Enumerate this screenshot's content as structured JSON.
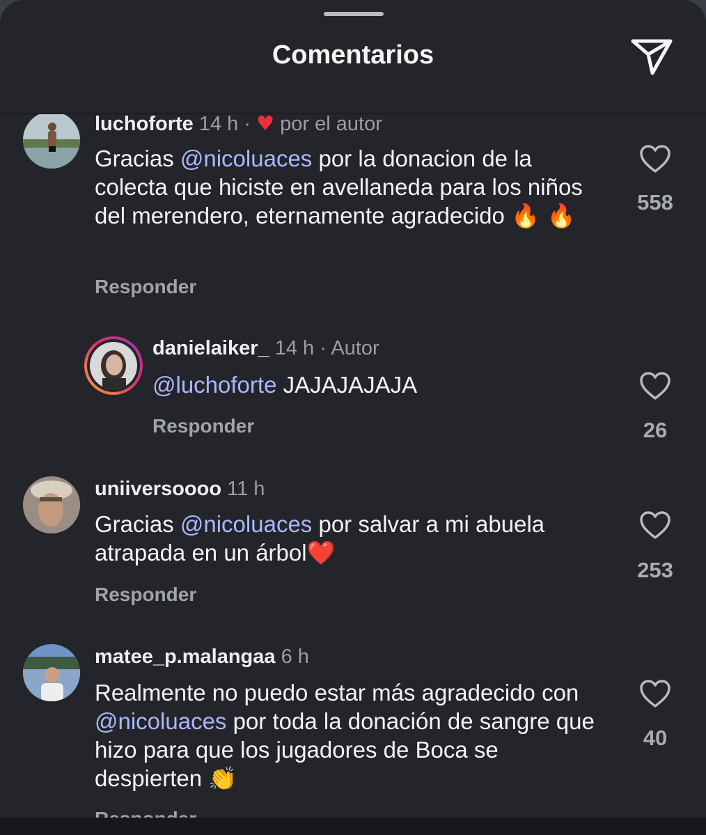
{
  "header": {
    "title": "Comentarios"
  },
  "comments": [
    {
      "username": "luchoforte",
      "time": "14 h",
      "separator": "·",
      "liked_by_author_label": "por el autor",
      "text_before": "Gracias ",
      "mention": "@nicoluaces",
      "text_after": " por la donacion de la colecta que hiciste en avellaneda para los niños del merendero, eternamente agradecido ",
      "emoji": "🔥 🔥",
      "reply_label": "Responder",
      "likes": "558"
    },
    {
      "username": "danielaiker_",
      "time": "14 h",
      "separator": "·",
      "author_label": "Autor",
      "mention": "@luchoforte",
      "text_after": " JAJAJAJAJA",
      "reply_label": "Responder",
      "likes": "26"
    },
    {
      "username": "uniiversoooo",
      "time": "11 h",
      "text_before": "Gracias ",
      "mention": "@nicoluaces",
      "text_after": " por salvar a mi abuela atrapada en un árbol",
      "emoji": "❤️",
      "reply_label": "Responder",
      "likes": "253"
    },
    {
      "username": "matee_p.malangaa",
      "time": "6 h",
      "text_before": "Realmente no puedo estar más agradecido con ",
      "mention": "@nicoluaces",
      "text_after": " por toda la donación de sangre que hizo para que los jugadores de Boca se despierten ",
      "emoji": "👏",
      "reply_label": "Responder",
      "likes": "40"
    }
  ],
  "colors": {
    "background": "#24252a",
    "mention": "#a9b8ff",
    "author_heart": "#ed2f3a",
    "story_ring": [
      "#f9a33a",
      "#e1306c",
      "#9b36b7"
    ]
  },
  "icons": [
    "send-icon",
    "heart-outline-icon",
    "heart-filled-icon"
  ]
}
